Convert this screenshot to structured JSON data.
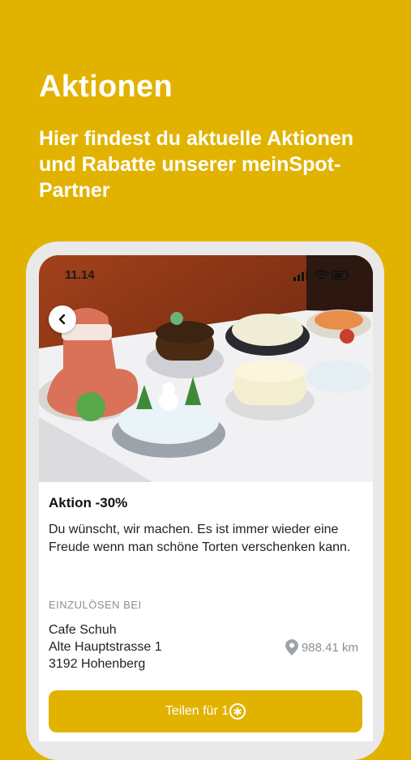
{
  "header": {
    "title": "Aktionen",
    "subtitle": "Hier findest du aktuelle Aktionen und Rabatte unserer meinSpot-Partner"
  },
  "status_bar": {
    "time": "11.14"
  },
  "deal": {
    "title": "Aktion -30%",
    "description": "Du wünscht, wir machen. Es ist immer wieder eine Freude wenn man schöne Torten verschenken kann."
  },
  "redeem": {
    "label": "EINZULÖSEN BEI",
    "name": "Cafe Schuh",
    "street": "Alte Hauptstrasse 1",
    "city": "3192 Hohenberg",
    "distance": "988.41 km"
  },
  "share_button": {
    "label": "Teilen für 1",
    "icon": "star-coin-icon"
  },
  "colors": {
    "brand": "#E1B300"
  }
}
